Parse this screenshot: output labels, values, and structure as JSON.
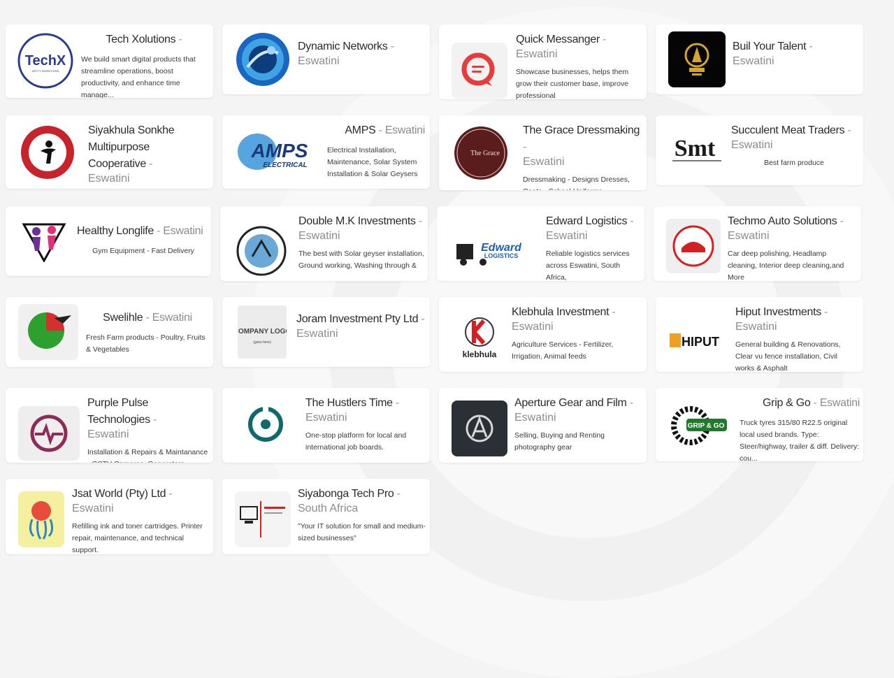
{
  "listings": [
    {
      "name": "Tech Xolutions",
      "location": "",
      "desc": "We build smart digital products that streamline operations, boost productivity, and enhance time manage...",
      "logo_icon": "techx-logo-icon"
    },
    {
      "name": "Dynamic Networks",
      "location": "Eswatini",
      "desc": "",
      "logo_icon": "dynamic-networks-logo-icon"
    },
    {
      "name": "Quick Messanger",
      "location": "Eswatini",
      "desc": "Showcase businesses, helps them grow their customer base, improve professional",
      "logo_icon": "quick-messanger-logo-icon"
    },
    {
      "name": "Buil Your Talent",
      "location": "Eswatini",
      "desc": "",
      "logo_icon": "buil-your-talent-logo-icon"
    },
    {
      "name": "Siyakhula Sonkhe Multipurpose Cooperative",
      "location": "Eswatini",
      "desc": "",
      "logo_icon": "siyakhula-logo-icon"
    },
    {
      "name": "AMPS",
      "location": "Eswatini",
      "desc": "Electrical Installation, Maintenance, Solar System Installation & Solar Geysers",
      "logo_icon": "amps-logo-icon",
      "logo_text": "AMPS",
      "logo_sub": "ELECTRICAL"
    },
    {
      "name": "The Grace Dressmaking",
      "location": "Eswatini",
      "desc": "Dressmaking - Designs Dresses, Coats - School Uniforms - Embroidery",
      "logo_icon": "grace-dressmaking-logo-icon",
      "logo_text": "The Grace"
    },
    {
      "name": "Succulent Meat Traders",
      "location": "Eswatini",
      "desc": "Best farm produce",
      "logo_icon": "succulent-logo-icon",
      "logo_text": "Smt"
    },
    {
      "name": "Healthy Longlife",
      "location": "Eswatini",
      "desc": "Gym Equipment - Fast Delivery",
      "logo_icon": "healthy-longlife-logo-icon"
    },
    {
      "name": "Double M.K Investments",
      "location": "Eswatini",
      "desc": "The best with Solar geyser installation, Ground working, Washing through &",
      "logo_icon": "double-mk-logo-icon"
    },
    {
      "name": "Edward Logistics",
      "location": "Eswatini",
      "desc": "Reliable logistics services across Eswatini, South Africa,",
      "logo_icon": "edward-logistics-logo-icon",
      "logo_text": "Edward",
      "logo_sub": "LOGISTICS"
    },
    {
      "name": "Techmo Auto Solutions",
      "location": "Eswatini",
      "desc": "Car deep polishing, Headlamp cleaning, Interior deep cleaning,and More",
      "logo_icon": "techmo-auto-logo-icon"
    },
    {
      "name": "Swelihle",
      "location": "Eswatini",
      "desc": "Fresh Farm products - Poultry, Fruits & Vegetables",
      "logo_icon": "swelihle-logo-icon"
    },
    {
      "name": "Joram Investment Pty Ltd",
      "location": "Eswatini",
      "desc": "",
      "logo_icon": "company-logo-placeholder-icon",
      "logo_text": "COMPANY LOGO",
      "logo_sub": "(goes here)"
    },
    {
      "name": "Klebhula Investment",
      "location": "Eswatini",
      "desc": "Agriculture Services - Fertilizer, Irrigation, Animal feeds",
      "logo_icon": "klebhula-logo-icon",
      "logo_text": "klebhula"
    },
    {
      "name": "Hiput Investments",
      "location": "Eswatini",
      "desc": "General building & Renovations, Clear vu fence installation, Civil works & Asphalt",
      "logo_icon": "hiput-logo-icon",
      "logo_text": "HIPUT"
    },
    {
      "name": "Purple Pulse Technologies",
      "location": "Eswatini",
      "desc": "Installation & Repairs & Maintanance - CCTV Cameras, Generators, Industrial",
      "logo_icon": "purple-pulse-logo-icon"
    },
    {
      "name": "The Hustlers Time",
      "location": "Eswatini",
      "desc": "One-stop platform for local and international job boards.",
      "logo_icon": "hustlers-time-logo-icon"
    },
    {
      "name": "Aperture Gear and Film",
      "location": "Eswatini",
      "desc": "Selling, Buying and Renting photography gear",
      "logo_icon": "aperture-logo-icon"
    },
    {
      "name": "Grip & Go",
      "location": "Eswatini",
      "desc": "Truck tyres 315/80 R22.5 original local used brands. Type: Steer/highway, trailer & diff. Delivery: cou...",
      "logo_icon": "grip-and-go-logo-icon",
      "logo_text": "GRIP & GO"
    },
    {
      "name": "Jsat World (Pty) Ltd",
      "location": "Eswatini",
      "desc": "Refilling ink and toner cartridges. Printer repair, maintenance, and technical support.",
      "logo_icon": "jsat-world-logo-icon"
    },
    {
      "name": "Siyabonga Tech Pro",
      "location": "South Africa",
      "desc": "\"Your IT solution for small and medium-sized businesses\"",
      "logo_icon": "siyabonga-tech-logo-icon"
    }
  ],
  "logo_texts": {
    "techx": "TechX",
    "techx_sub": "ARTTY INVENTIONS"
  },
  "colors": {
    "background": "#f4f4f5",
    "card": "#ffffff",
    "title": "#2b2b2b",
    "location": "#8c8c8c"
  }
}
